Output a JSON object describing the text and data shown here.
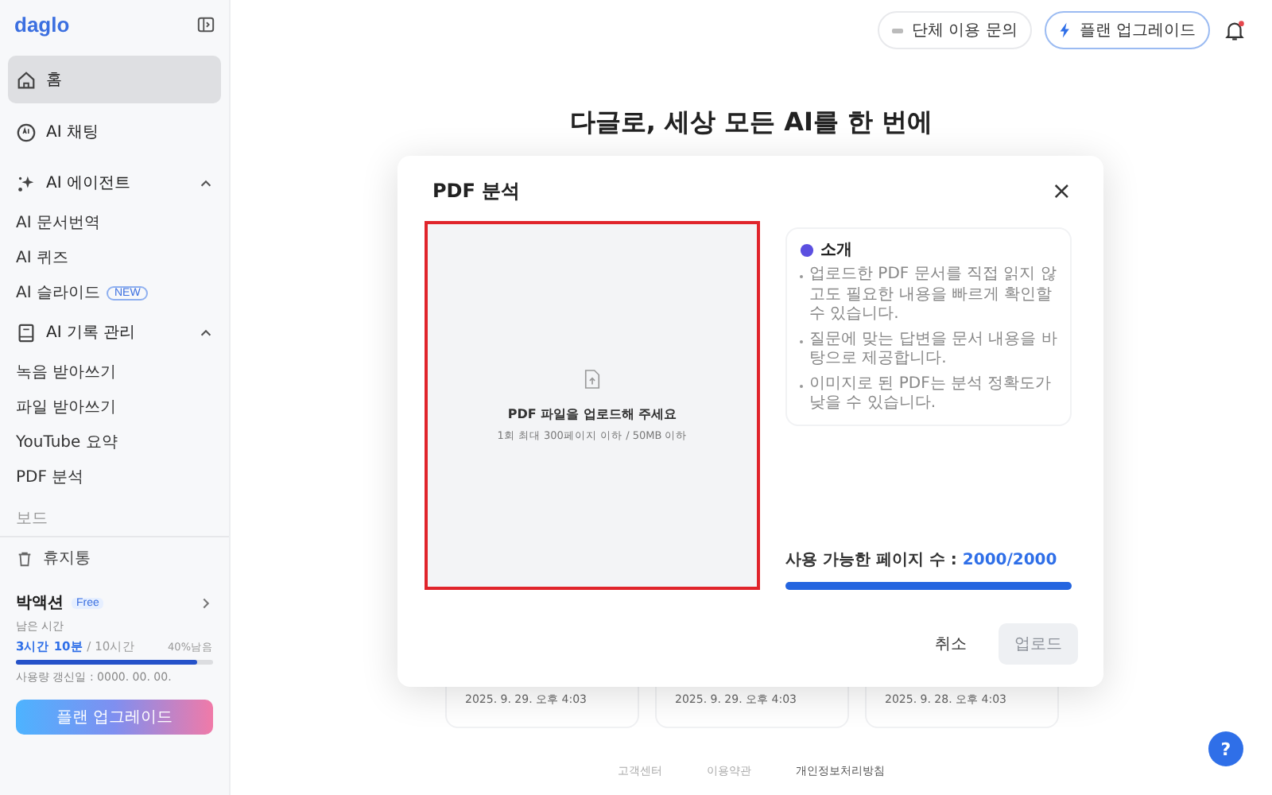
{
  "sidebar": {
    "logo": "daglo",
    "nav": [
      {
        "label": "홈",
        "selected": true
      },
      {
        "label": "AI 채팅",
        "selected": false
      }
    ],
    "groups": [
      {
        "label": "AI 에이전트",
        "expanded": true,
        "items": [
          {
            "label": "AI 문서번역",
            "selected": false
          },
          {
            "label": "AI 퀴즈",
            "selected": false
          },
          {
            "label": "AI 슬라이드",
            "badge": "NEW",
            "selected": false
          }
        ]
      },
      {
        "label": "AI 기록 관리",
        "expanded": true,
        "items": [
          {
            "label": "녹음 받아쓰기",
            "selected": false
          },
          {
            "label": "파일 받아쓰기",
            "selected": false
          },
          {
            "label": "YouTube 요약",
            "selected": false
          },
          {
            "label": "PDF 분석",
            "selected": false
          }
        ]
      }
    ],
    "section_label": "보드",
    "trash": "휴지통",
    "user": {
      "name": "박액션",
      "plan": "Free",
      "remaining_label": "남은 시간",
      "remaining": "3시간 10분",
      "total": " / 10시간",
      "percent": "40%남음",
      "level": 0.92,
      "renewal": "사용량 갱신일 : 0000. 00. 00.",
      "upgrade": "플랜 업그레이드"
    }
  },
  "header": {
    "contact": "단체 이용 문의",
    "upgrade": "플랜 업그레이드",
    "notification": true
  },
  "headline": "다글로, 세상 모든 AI를 한 번에",
  "cards": [
    {
      "date": "2025. 9. 29. 오후 4:03"
    },
    {
      "date": "2025. 9. 29. 오후 4:03"
    },
    {
      "date": "2025. 9. 28. 오후 4:03"
    }
  ],
  "footer": [
    {
      "label": "고객센터",
      "emphasis": false
    },
    {
      "label": "이용약관",
      "emphasis": false
    },
    {
      "label": "개인정보처리방침",
      "emphasis": true
    }
  ],
  "help": "?",
  "dialog": {
    "title": "PDF 분석",
    "close": "×",
    "dropzone": {
      "title": "PDF 파일을 업로드해 주세요",
      "hint": "1회 최대 300페이지 이하 / 50MB 이하"
    },
    "intro": {
      "title": "소개",
      "bullets": [
        "업로드한 PDF 문서를 직접 읽지 않고도 필요한 내용을 빠르게 확인할 수 있습니다.",
        "질문에 맞는 답변을 문서 내용을 바탕으로 제공합니다.",
        "이미지로 된 PDF는 분석 정확도가 낮을 수 있습니다."
      ]
    },
    "pages_label": "사용 가능한 페이지 수 : ",
    "pages_value": "2000/2000",
    "pages_level": {
      "level": 1
    },
    "buttons": [
      {
        "label": "취소",
        "kind": "text",
        "disabled": false
      },
      {
        "label": "업로드",
        "kind": "primary",
        "disabled": true
      }
    ]
  }
}
